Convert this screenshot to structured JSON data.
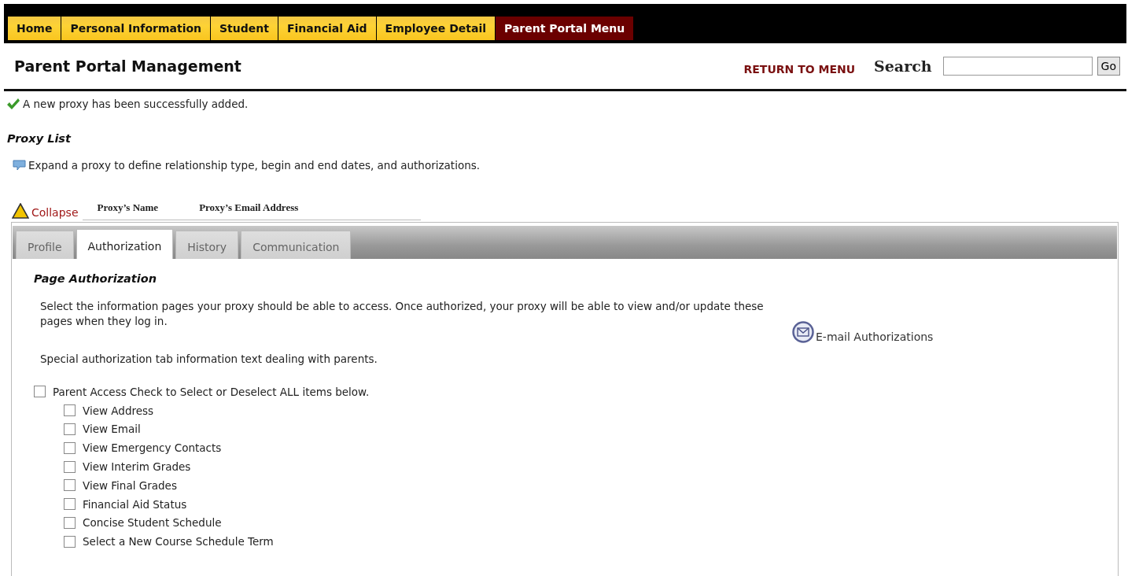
{
  "nav_tabs": [
    {
      "label": "Home",
      "selected": false
    },
    {
      "label": "Personal Information",
      "selected": false
    },
    {
      "label": "Student",
      "selected": false
    },
    {
      "label": "Financial Aid",
      "selected": false
    },
    {
      "label": "Employee Detail",
      "selected": false
    },
    {
      "label": "Parent Portal Menu",
      "selected": true
    }
  ],
  "page_title": "Parent Portal Management",
  "return_link": "RETURN TO MENU",
  "search": {
    "label": "Search",
    "button": "Go"
  },
  "success_message": "A new proxy has been successfully added.",
  "section_title": "Proxy List",
  "info_text": "Expand a proxy to define relationship type, begin and end dates, and authorizations.",
  "proxy_header": {
    "collapse": "Collapse",
    "columns": [
      "Proxy’s Name",
      "Proxy’s Email Address"
    ]
  },
  "tabs": [
    {
      "label": "Profile",
      "selected": false
    },
    {
      "label": "Authorization",
      "selected": true
    },
    {
      "label": "History",
      "selected": false
    },
    {
      "label": "Communication",
      "selected": false
    }
  ],
  "authorization": {
    "title": "Page Authorization",
    "description": "Select the information pages your proxy should be able to access. Once authorized, your proxy will be able to view and/or update these pages when they log in.",
    "note": "Special authorization tab information text dealing with parents.",
    "email_link": "E-mail Authorizations",
    "items": [
      {
        "label": "Parent Access Check to Select or Deselect ALL items below.",
        "checked": false,
        "children": [
          {
            "label": "View Address",
            "checked": false
          },
          {
            "label": "View Email",
            "checked": false
          },
          {
            "label": "View Emergency Contacts",
            "checked": false
          },
          {
            "label": "View Interim Grades",
            "checked": false
          },
          {
            "label": "View Final Grades",
            "checked": false
          },
          {
            "label": "Financial Aid Status",
            "checked": false
          },
          {
            "label": "Concise Student Schedule",
            "checked": false
          },
          {
            "label": "Select a New Course Schedule Term",
            "checked": false
          }
        ]
      }
    ]
  }
}
